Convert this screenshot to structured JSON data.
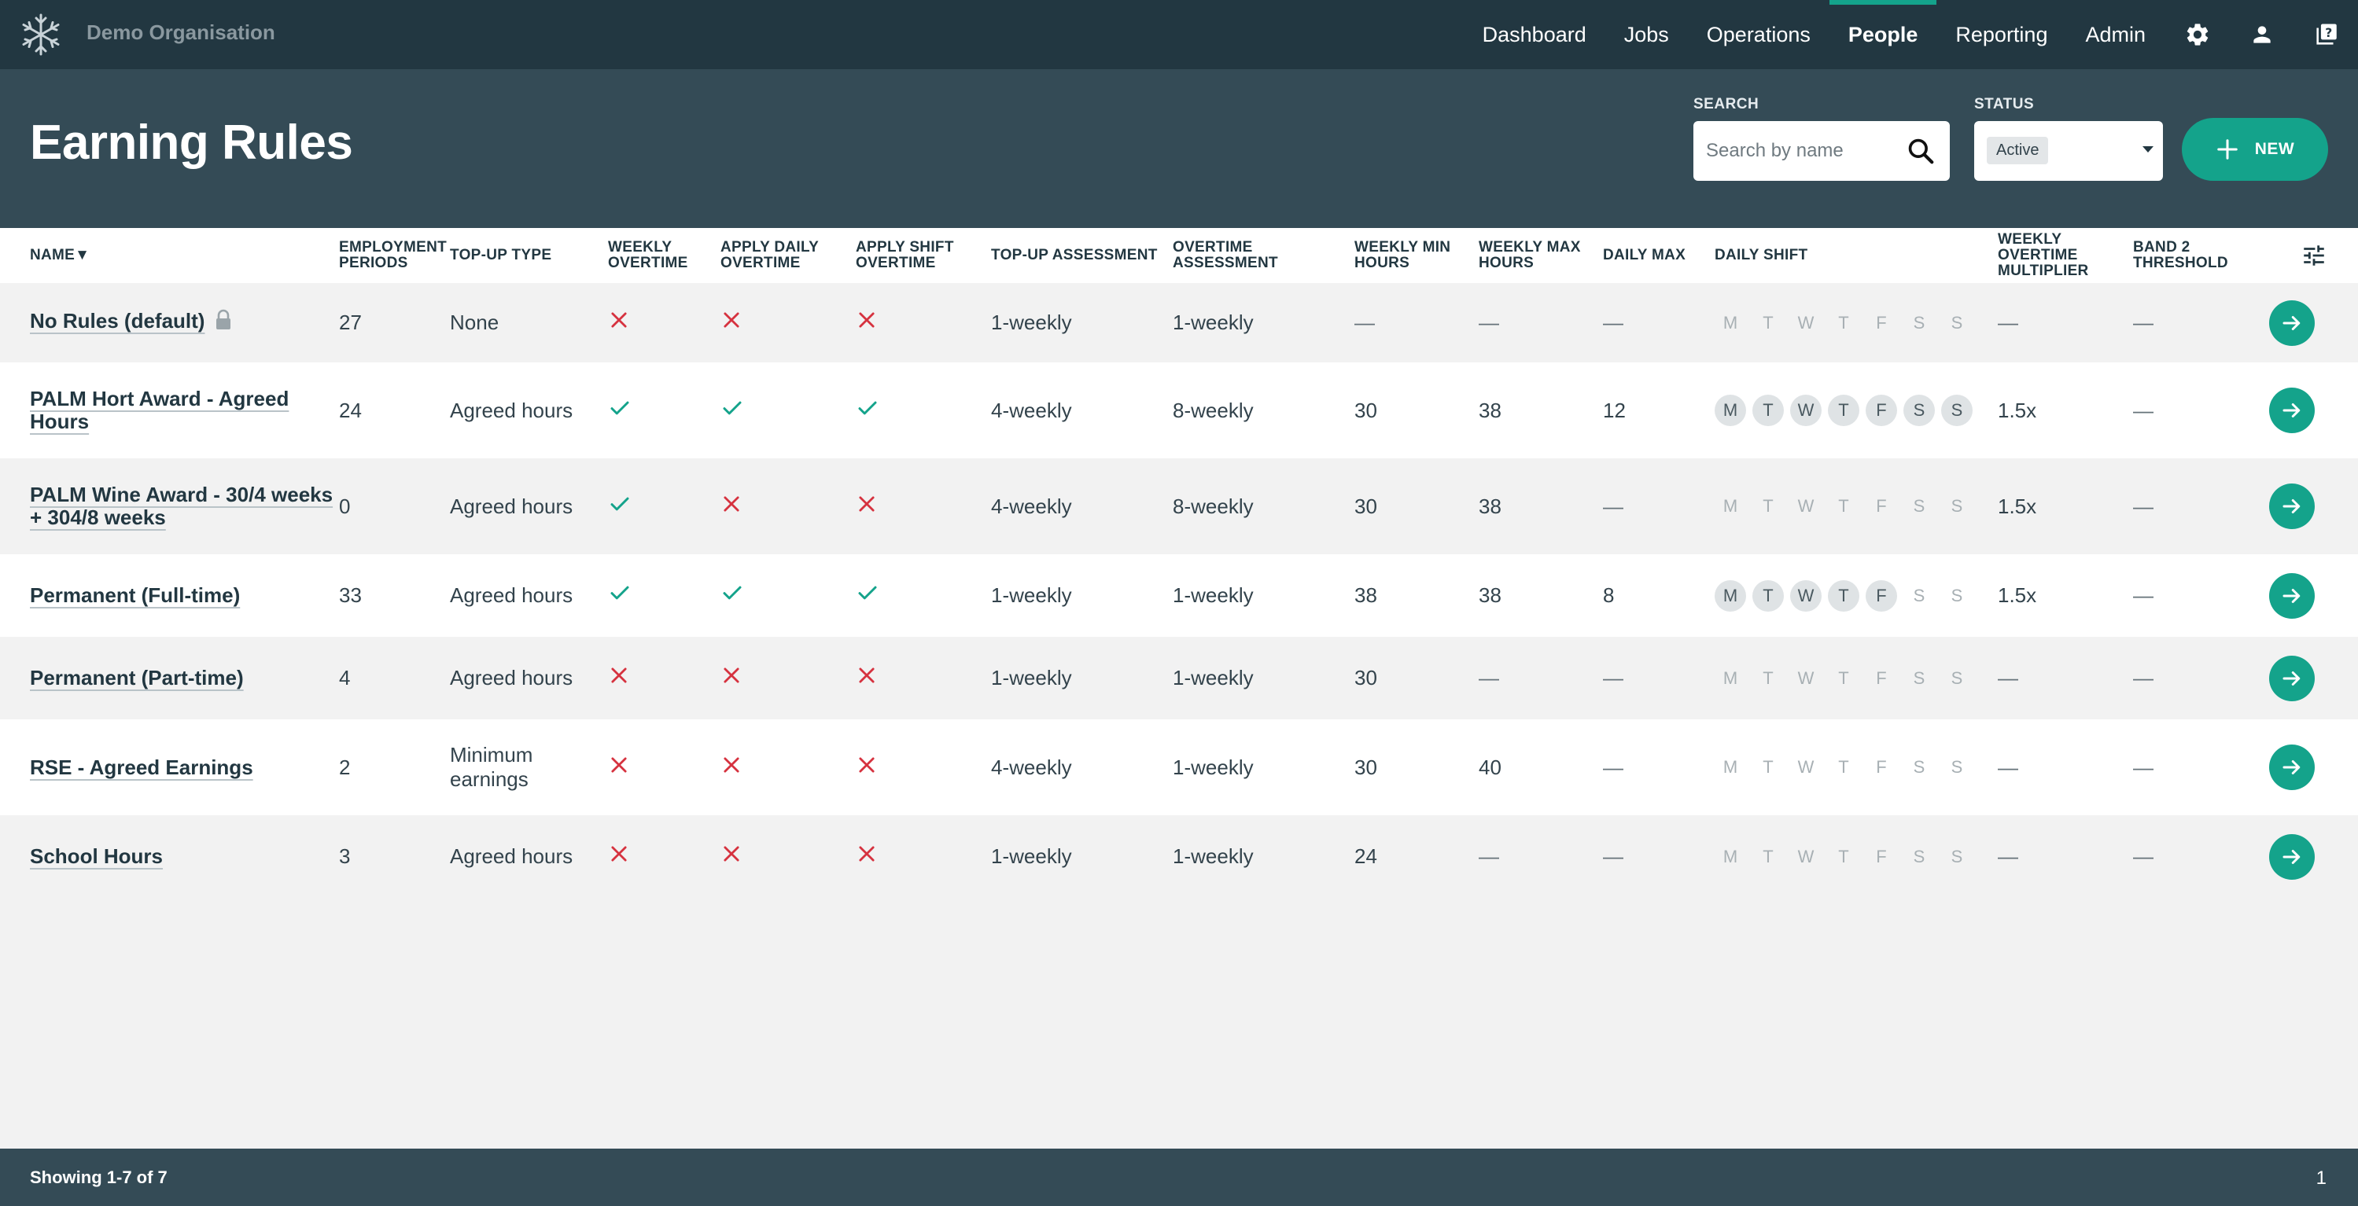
{
  "app": {
    "org_name": "Demo Organisation"
  },
  "nav": {
    "links": [
      {
        "label": "Dashboard",
        "active": false
      },
      {
        "label": "Jobs",
        "active": false
      },
      {
        "label": "Operations",
        "active": false
      },
      {
        "label": "People",
        "active": true
      },
      {
        "label": "Reporting",
        "active": false
      },
      {
        "label": "Admin",
        "active": false
      }
    ],
    "icons": [
      "gear-icon",
      "user-icon",
      "help-icon"
    ]
  },
  "header": {
    "title": "Earning Rules",
    "search_label": "SEARCH",
    "search_placeholder": "Search by name",
    "status_label": "STATUS",
    "status_value": "Active",
    "new_label": "NEW"
  },
  "table": {
    "columns": [
      "NAME▼",
      "EMPLOYMENT PERIODS",
      "TOP-UP TYPE",
      "WEEKLY OVERTIME",
      "APPLY DAILY OVERTIME",
      "APPLY SHIFT OVERTIME",
      "TOP-UP ASSESSMENT",
      "OVERTIME ASSESSMENT",
      "WEEKLY MIN HOURS",
      "WEEKLY MAX HOURS",
      "DAILY MAX",
      "DAILY SHIFT",
      "WEEKLY OVERTIME MULTIPLIER",
      "BAND 2 THRESHOLD"
    ],
    "day_letters": [
      "M",
      "T",
      "W",
      "T",
      "F",
      "S",
      "S"
    ],
    "rows": [
      {
        "name": "No Rules (default)",
        "locked": true,
        "periods": "27",
        "topup_type": "None",
        "weekly_ot": false,
        "daily_ot": false,
        "shift_ot": false,
        "topup_assess": "1-weekly",
        "ot_assess": "1-weekly",
        "min_hours": "—",
        "max_hours": "—",
        "daily_max": "—",
        "shift_days": [
          false,
          false,
          false,
          false,
          false,
          false,
          false
        ],
        "multiplier": "—",
        "band2": "—"
      },
      {
        "name": "PALM Hort Award - Agreed Hours",
        "locked": false,
        "periods": "24",
        "topup_type": "Agreed hours",
        "weekly_ot": true,
        "daily_ot": true,
        "shift_ot": true,
        "topup_assess": "4-weekly",
        "ot_assess": "8-weekly",
        "min_hours": "30",
        "max_hours": "38",
        "daily_max": "12",
        "shift_days": [
          true,
          true,
          true,
          true,
          true,
          true,
          true
        ],
        "multiplier": "1.5x",
        "band2": "—"
      },
      {
        "name": "PALM Wine Award - 30/4 weeks + 304/8 weeks",
        "locked": false,
        "periods": "0",
        "topup_type": "Agreed hours",
        "weekly_ot": true,
        "daily_ot": false,
        "shift_ot": false,
        "topup_assess": "4-weekly",
        "ot_assess": "8-weekly",
        "min_hours": "30",
        "max_hours": "38",
        "daily_max": "—",
        "shift_days": [
          false,
          false,
          false,
          false,
          false,
          false,
          false
        ],
        "multiplier": "1.5x",
        "band2": "—"
      },
      {
        "name": "Permanent (Full-time)",
        "locked": false,
        "periods": "33",
        "topup_type": "Agreed hours",
        "weekly_ot": true,
        "daily_ot": true,
        "shift_ot": true,
        "topup_assess": "1-weekly",
        "ot_assess": "1-weekly",
        "min_hours": "38",
        "max_hours": "38",
        "daily_max": "8",
        "shift_days": [
          true,
          true,
          true,
          true,
          true,
          false,
          false
        ],
        "multiplier": "1.5x",
        "band2": "—"
      },
      {
        "name": "Permanent (Part-time)",
        "locked": false,
        "periods": "4",
        "topup_type": "Agreed hours",
        "weekly_ot": false,
        "daily_ot": false,
        "shift_ot": false,
        "topup_assess": "1-weekly",
        "ot_assess": "1-weekly",
        "min_hours": "30",
        "max_hours": "—",
        "daily_max": "—",
        "shift_days": [
          false,
          false,
          false,
          false,
          false,
          false,
          false
        ],
        "multiplier": "—",
        "band2": "—"
      },
      {
        "name": "RSE - Agreed Earnings",
        "locked": false,
        "periods": "2",
        "topup_type": "Minimum earnings",
        "weekly_ot": false,
        "daily_ot": false,
        "shift_ot": false,
        "topup_assess": "4-weekly",
        "ot_assess": "1-weekly",
        "min_hours": "30",
        "max_hours": "40",
        "daily_max": "—",
        "shift_days": [
          false,
          false,
          false,
          false,
          false,
          false,
          false
        ],
        "multiplier": "—",
        "band2": "—"
      },
      {
        "name": "School Hours",
        "locked": false,
        "periods": "3",
        "topup_type": "Agreed hours",
        "weekly_ot": false,
        "daily_ot": false,
        "shift_ot": false,
        "topup_assess": "1-weekly",
        "ot_assess": "1-weekly",
        "min_hours": "24",
        "max_hours": "—",
        "daily_max": "—",
        "shift_days": [
          false,
          false,
          false,
          false,
          false,
          false,
          false
        ],
        "multiplier": "—",
        "band2": "—"
      }
    ]
  },
  "footer": {
    "showing": "Showing 1-7 of 7",
    "page": "1"
  },
  "colors": {
    "accent": "#14a38b",
    "nav_bg": "#223741",
    "header_bg": "#344b56",
    "check": "#14a38b",
    "cross": "#d6323f"
  }
}
